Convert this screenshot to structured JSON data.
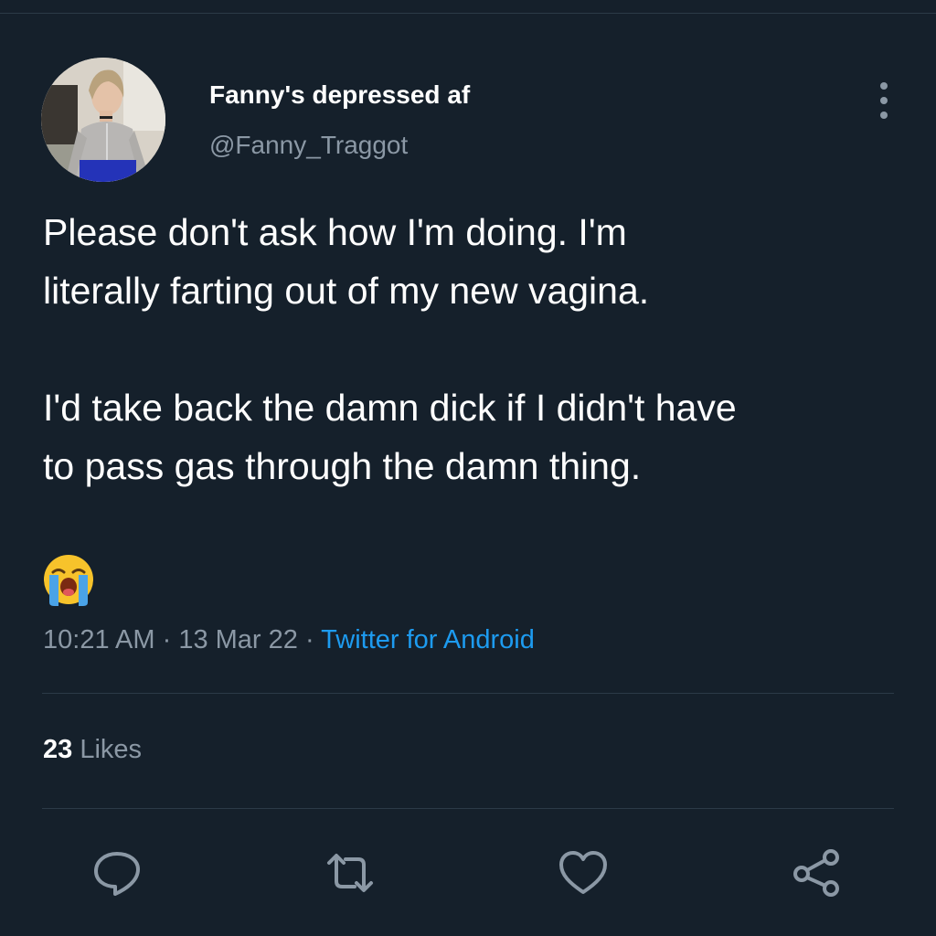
{
  "author": {
    "display_name": "Fanny's depressed af",
    "handle": "@Fanny_Traggot"
  },
  "tweet": {
    "paragraphs": [
      "Please don't ask how I'm doing. I'm literally farting out of my new vagina.",
      "I'd take back the damn dick if I didn't have to pass gas through the damn thing."
    ],
    "line_texts": [
      "Please don't ask how I'm doing. I'm",
      "literally farting out of my new vagina.",
      "I'd take back the damn dick if I didn't have",
      "to pass gas through the damn thing."
    ],
    "emoji": "loudly-crying-face"
  },
  "meta": {
    "time": "10:21 AM",
    "separator": " · ",
    "date": "13 Mar 22",
    "source": "Twitter for Android"
  },
  "stats": {
    "likes_count": "23",
    "likes_label": "Likes"
  },
  "actions": [
    {
      "name": "reply",
      "icon": "reply-icon"
    },
    {
      "name": "retweet",
      "icon": "retweet-icon"
    },
    {
      "name": "like",
      "icon": "heart-icon"
    },
    {
      "name": "share",
      "icon": "share-icon"
    }
  ],
  "colors": {
    "background": "#15202b",
    "primary_text": "#ffffff",
    "secondary_text": "#8b98a5",
    "accent": "#1d9bf0",
    "divider": "#2c3a47"
  }
}
